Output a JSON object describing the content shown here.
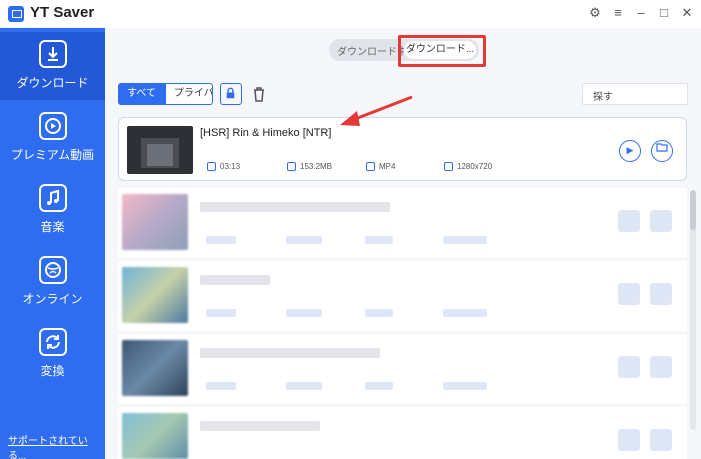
{
  "app": {
    "title": "YT Saver"
  },
  "window_controls": [
    "⚙",
    "≡",
    "–",
    "□",
    "✕"
  ],
  "sidebar": {
    "items": [
      {
        "label": "ダウンロード",
        "icon": "download-icon"
      },
      {
        "label": "プレミアム動画",
        "icon": "play-icon"
      },
      {
        "label": "音楽",
        "icon": "music-icon"
      },
      {
        "label": "オンライン",
        "icon": "globe-icon"
      },
      {
        "label": "変換",
        "icon": "convert-icon"
      }
    ],
    "footer_link": "サポートされている..."
  },
  "tabs": {
    "downloading": "ダウンロード中",
    "downloaded": "ダウンロード..."
  },
  "filters": {
    "all": "すべて",
    "private": "プライバ..."
  },
  "search": {
    "placeholder": "探す"
  },
  "item": {
    "title": "[HSR] Rin & Himeko [NTR]",
    "duration": "03:13",
    "size": "153.2MB",
    "format": "MP4",
    "resolution": "1280x720"
  },
  "colors": {
    "accent": "#2f6df0",
    "highlight": "#e53935"
  }
}
